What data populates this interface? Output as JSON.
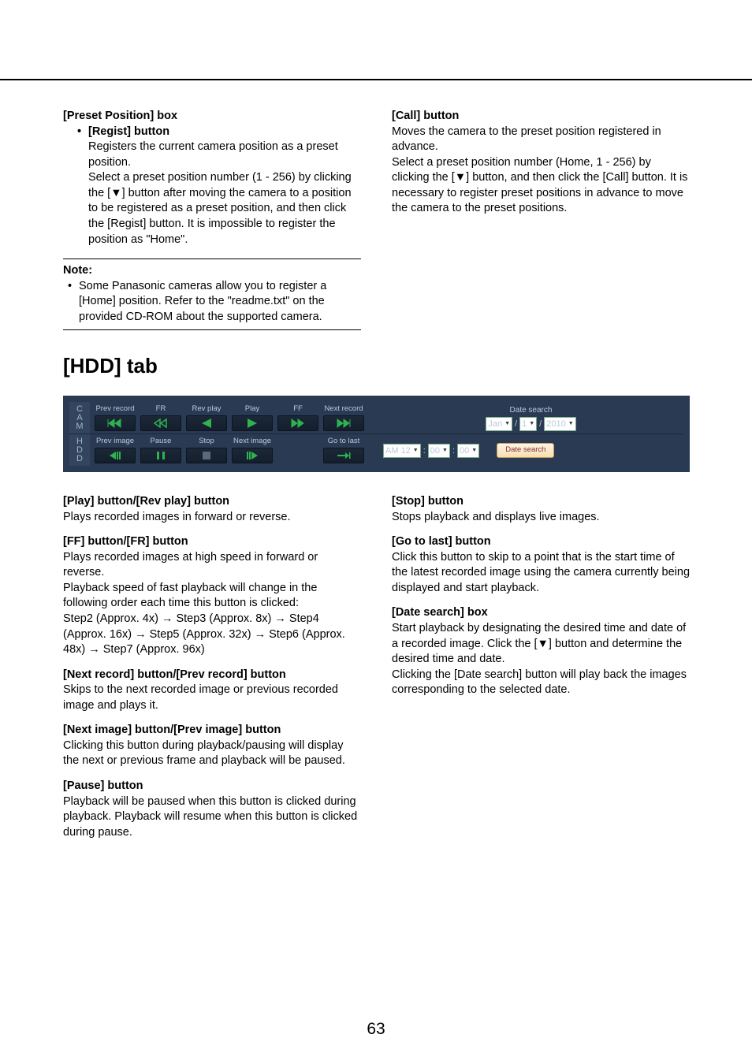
{
  "col1": {
    "preset_position_box": "[Preset Position] box",
    "regist_button": "[Regist] button",
    "bullet1": "•",
    "regist_p1": "Registers the current camera position as a preset position.",
    "regist_p2": "Select a preset position number (1 - 256) by clicking the [▼] button after moving the camera to a position to be registered as a preset position, and then click the [Regist] button. It is impossible to register the position as \"Home\".",
    "note_hdr": "Note:",
    "note_bullet": "•",
    "note_text": "Some Panasonic cameras allow you to register a [Home] position. Refer to the \"readme.txt\" on the provided CD-ROM about the supported camera."
  },
  "col2_top": {
    "call_hdr": "[Call] button",
    "call_p1": "Moves the camera to the preset position registered in advance.",
    "call_p2": "Select a preset position number (Home, 1 - 256) by clicking the [▼] button, and then click the [Call] button. It is necessary to register preset positions in advance to move the camera to the preset positions."
  },
  "section_hdd": "[HDD] tab",
  "panel": {
    "side1": "CAM",
    "side2": "HDD",
    "row1_labels": [
      "Prev record",
      "FR",
      "Rev play",
      "Play",
      "FF",
      "Next record"
    ],
    "row2_labels": [
      "Prev image",
      "Pause",
      "Stop",
      "Next image",
      "Go to last"
    ],
    "ds_title": "Date search",
    "month": "Jan",
    "day": "1",
    "year": "2010",
    "ampm": "AM 12",
    "min": "00",
    "sec": "00",
    "ds_btn": "Date search"
  },
  "left_body": {
    "h1": "[Play] button/[Rev play] button",
    "p1": "Plays recorded images in forward or reverse.",
    "h2": "[FF] button/[FR] button",
    "p2a": "Plays recorded images at high speed in forward or reverse.",
    "p2b": "Playback speed of fast playback will change in the following order each time this button is clicked:",
    "p2c": "Step2 (Approx. 4x) → Step3 (Approx. 8x) → Step4 (Approx. 16x) → Step5 (Approx. 32x) → Step6 (Approx. 48x) → Step7 (Approx. 96x)",
    "h3": "[Next record] button/[Prev record] button",
    "p3": "Skips to the next recorded image or previous recorded image and plays it.",
    "h4": "[Next image] button/[Prev image] button",
    "p4": "Clicking this button during playback/pausing will display the next or previous frame and playback will be paused.",
    "h5": "[Pause] button",
    "p5": "Playback will be paused when this button is clicked during playback. Playback will resume when this button is clicked during pause."
  },
  "right_body": {
    "h1": "[Stop] button",
    "p1": "Stops playback and displays live images.",
    "h2": "[Go to last] button",
    "p2": "Click this button to skip to a point that is the start time of the latest recorded image using the camera currently being displayed and start playback.",
    "h3": "[Date search] box",
    "p3a": "Start playback by designating the desired time and date of a recorded image. Click the [▼] button and determine the desired time and date.",
    "p3b": "Clicking the [Date search] button will play back the images corresponding to the selected date."
  },
  "page": "63"
}
